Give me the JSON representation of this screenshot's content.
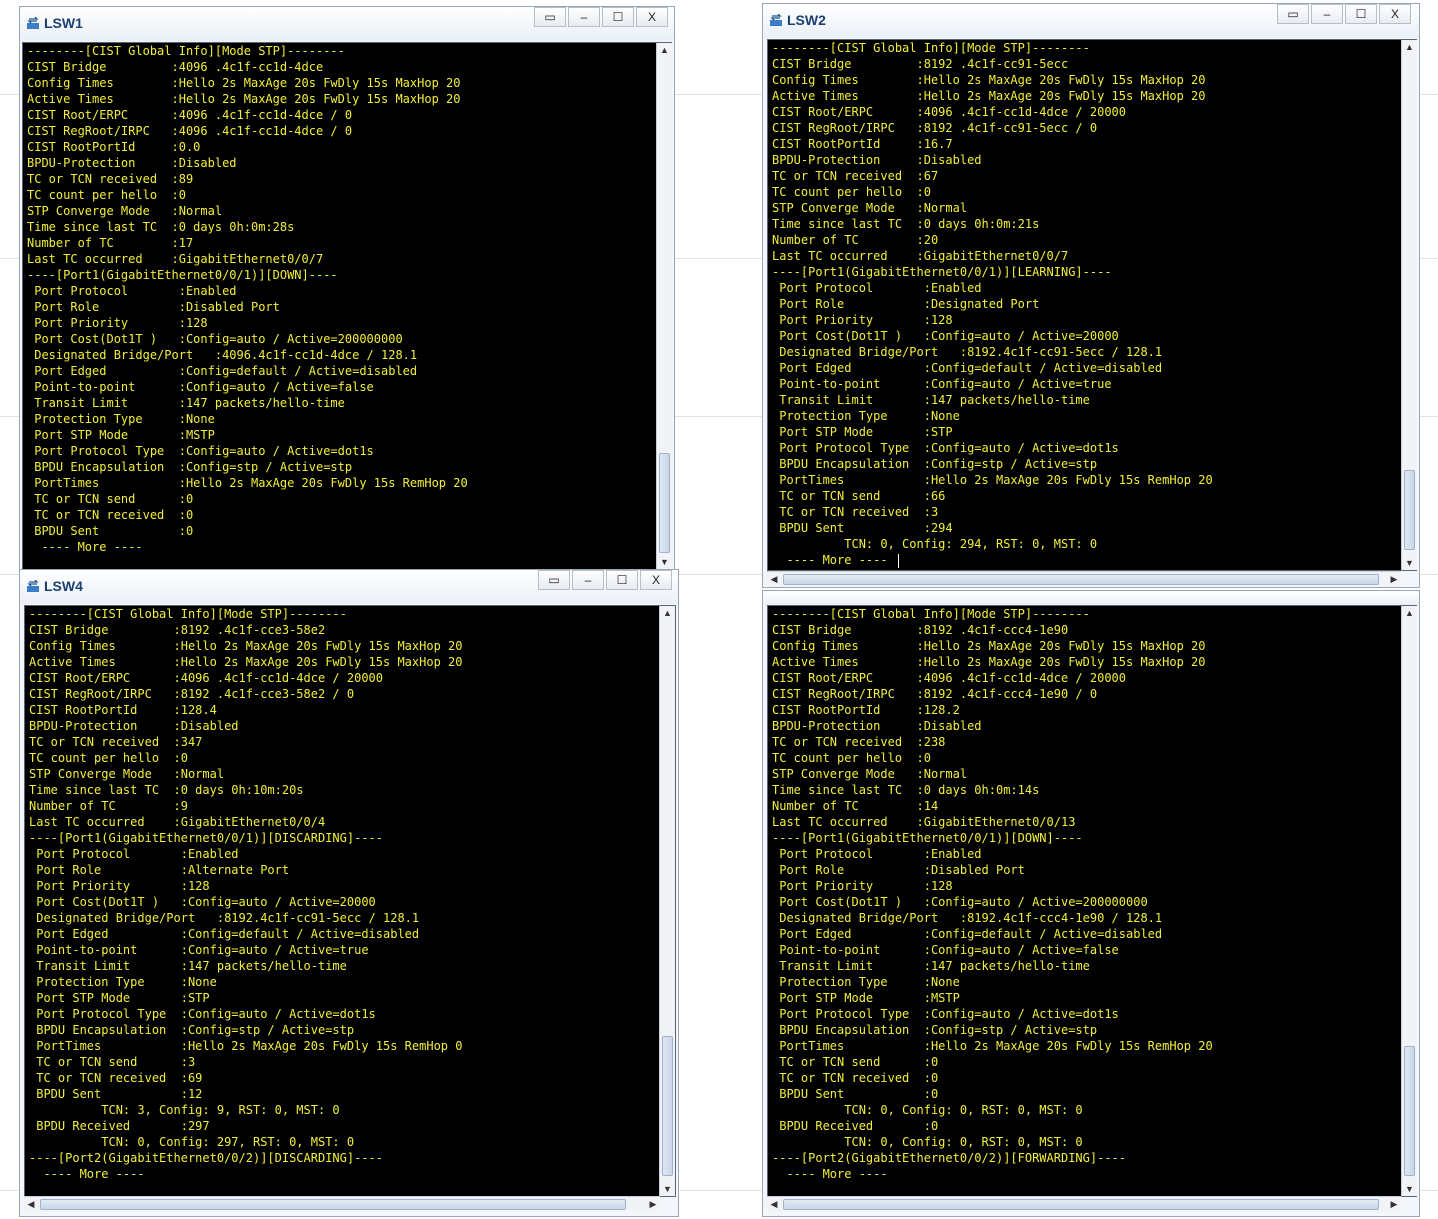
{
  "windows": {
    "lsw1": {
      "title": "LSW1",
      "restore_glyph": "▭",
      "min_glyph": "–",
      "max_glyph": "☐",
      "close_glyph": "X",
      "text": "--------[CIST Global Info][Mode STP]--------\nCIST Bridge         :4096 .4c1f-cc1d-4dce\nConfig Times        :Hello 2s MaxAge 20s FwDly 15s MaxHop 20\nActive Times        :Hello 2s MaxAge 20s FwDly 15s MaxHop 20\nCIST Root/ERPC      :4096 .4c1f-cc1d-4dce / 0\nCIST RegRoot/IRPC   :4096 .4c1f-cc1d-4dce / 0\nCIST RootPortId     :0.0\nBPDU-Protection     :Disabled\nTC or TCN received  :89\nTC count per hello  :0\nSTP Converge Mode   :Normal\nTime since last TC  :0 days 0h:0m:28s\nNumber of TC        :17\nLast TC occurred    :GigabitEthernet0/0/7\n----[Port1(GigabitEthernet0/0/1)][DOWN]----\n Port Protocol       :Enabled\n Port Role           :Disabled Port\n Port Priority       :128\n Port Cost(Dot1T )   :Config=auto / Active=200000000\n Designated Bridge/Port   :4096.4c1f-cc1d-4dce / 128.1\n Port Edged          :Config=default / Active=disabled\n Point-to-point      :Config=auto / Active=false\n Transit Limit       :147 packets/hello-time\n Protection Type     :None\n Port STP Mode       :MSTP\n Port Protocol Type  :Config=auto / Active=dot1s\n BPDU Encapsulation  :Config=stp / Active=stp\n PortTimes           :Hello 2s MaxAge 20s FwDly 15s RemHop 20\n TC or TCN send      :0\n TC or TCN received  :0\n BPDU Sent           :0\n  ---- More ----"
    },
    "lsw2": {
      "title": "LSW2",
      "restore_glyph": "▭",
      "min_glyph": "–",
      "max_glyph": "☐",
      "close_glyph": "X",
      "text": "--------[CIST Global Info][Mode STP]--------\nCIST Bridge         :8192 .4c1f-cc91-5ecc\nConfig Times        :Hello 2s MaxAge 20s FwDly 15s MaxHop 20\nActive Times        :Hello 2s MaxAge 20s FwDly 15s MaxHop 20\nCIST Root/ERPC      :4096 .4c1f-cc1d-4dce / 20000\nCIST RegRoot/IRPC   :8192 .4c1f-cc91-5ecc / 0\nCIST RootPortId     :16.7\nBPDU-Protection     :Disabled\nTC or TCN received  :67\nTC count per hello  :0\nSTP Converge Mode   :Normal\nTime since last TC  :0 days 0h:0m:21s\nNumber of TC        :20\nLast TC occurred    :GigabitEthernet0/0/7\n----[Port1(GigabitEthernet0/0/1)][LEARNING]----\n Port Protocol       :Enabled\n Port Role           :Designated Port\n Port Priority       :128\n Port Cost(Dot1T )   :Config=auto / Active=20000\n Designated Bridge/Port   :8192.4c1f-cc91-5ecc / 128.1\n Port Edged          :Config=default / Active=disabled\n Point-to-point      :Config=auto / Active=true\n Transit Limit       :147 packets/hello-time\n Protection Type     :None\n Port STP Mode       :STP\n Port Protocol Type  :Config=auto / Active=dot1s\n BPDU Encapsulation  :Config=stp / Active=stp\n PortTimes           :Hello 2s MaxAge 20s FwDly 15s RemHop 20\n TC or TCN send      :66\n TC or TCN received  :3\n BPDU Sent           :294\n          TCN: 0, Config: 294, RST: 0, MST: 0\n  ---- More ----"
    },
    "lsw4": {
      "title": "LSW4",
      "restore_glyph": "▭",
      "min_glyph": "–",
      "max_glyph": "☐",
      "close_glyph": "X",
      "text": "--------[CIST Global Info][Mode STP]--------\nCIST Bridge         :8192 .4c1f-cce3-58e2\nConfig Times        :Hello 2s MaxAge 20s FwDly 15s MaxHop 20\nActive Times        :Hello 2s MaxAge 20s FwDly 15s MaxHop 20\nCIST Root/ERPC      :4096 .4c1f-cc1d-4dce / 20000\nCIST RegRoot/IRPC   :8192 .4c1f-cce3-58e2 / 0\nCIST RootPortId     :128.4\nBPDU-Protection     :Disabled\nTC or TCN received  :347\nTC count per hello  :0\nSTP Converge Mode   :Normal\nTime since last TC  :0 days 0h:10m:20s\nNumber of TC        :9\nLast TC occurred    :GigabitEthernet0/0/4\n----[Port1(GigabitEthernet0/0/1)][DISCARDING]----\n Port Protocol       :Enabled\n Port Role           :Alternate Port\n Port Priority       :128\n Port Cost(Dot1T )   :Config=auto / Active=20000\n Designated Bridge/Port   :8192.4c1f-cc91-5ecc / 128.1\n Port Edged          :Config=default / Active=disabled\n Point-to-point      :Config=auto / Active=true\n Transit Limit       :147 packets/hello-time\n Protection Type     :None\n Port STP Mode       :STP\n Port Protocol Type  :Config=auto / Active=dot1s\n BPDU Encapsulation  :Config=stp / Active=stp\n PortTimes           :Hello 2s MaxAge 20s FwDly 15s RemHop 0\n TC or TCN send      :3\n TC or TCN received  :69\n BPDU Sent           :12\n          TCN: 3, Config: 9, RST: 0, MST: 0\n BPDU Received       :297\n          TCN: 0, Config: 297, RST: 0, MST: 0\n----[Port2(GigabitEthernet0/0/2)][DISCARDING]----\n  ---- More ----"
    },
    "lsw3": {
      "text": "--------[CIST Global Info][Mode STP]--------\nCIST Bridge         :8192 .4c1f-ccc4-1e90\nConfig Times        :Hello 2s MaxAge 20s FwDly 15s MaxHop 20\nActive Times        :Hello 2s MaxAge 20s FwDly 15s MaxHop 20\nCIST Root/ERPC      :4096 .4c1f-cc1d-4dce / 20000\nCIST RegRoot/IRPC   :8192 .4c1f-ccc4-1e90 / 0\nCIST RootPortId     :128.2\nBPDU-Protection     :Disabled\nTC or TCN received  :238\nTC count per hello  :0\nSTP Converge Mode   :Normal\nTime since last TC  :0 days 0h:0m:14s\nNumber of TC        :14\nLast TC occurred    :GigabitEthernet0/0/13\n----[Port1(GigabitEthernet0/0/1)][DOWN]----\n Port Protocol       :Enabled\n Port Role           :Disabled Port\n Port Priority       :128\n Port Cost(Dot1T )   :Config=auto / Active=200000000\n Designated Bridge/Port   :8192.4c1f-ccc4-1e90 / 128.1\n Port Edged          :Config=default / Active=disabled\n Point-to-point      :Config=auto / Active=false\n Transit Limit       :147 packets/hello-time\n Protection Type     :None\n Port STP Mode       :MSTP\n Port Protocol Type  :Config=auto / Active=dot1s\n BPDU Encapsulation  :Config=stp / Active=stp\n PortTimes           :Hello 2s MaxAge 20s FwDly 15s RemHop 20\n TC or TCN send      :0\n TC or TCN received  :0\n BPDU Sent           :0\n          TCN: 0, Config: 0, RST: 0, MST: 0\n BPDU Received       :0\n          TCN: 0, Config: 0, RST: 0, MST: 0\n----[Port2(GigabitEthernet0/0/2)][FORWARDING]----\n  ---- More ----"
    }
  },
  "scroll": {
    "up_arrow": "▲",
    "down_arrow": "▼",
    "left_arrow": "◀",
    "right_arrow": "▶"
  },
  "colors": {
    "terminal_bg": "#000000",
    "terminal_text": "#f2ef3a",
    "title_text": "#1b3e73"
  }
}
